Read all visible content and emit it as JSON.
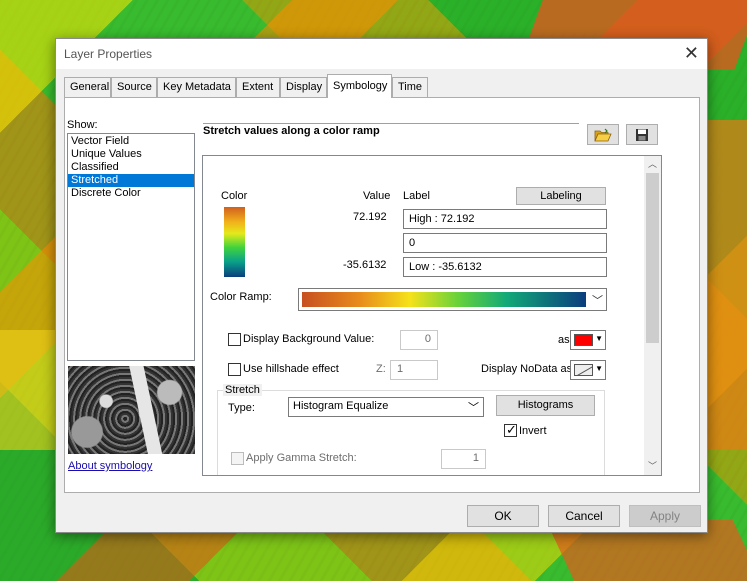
{
  "dialog": {
    "title": "Layer Properties",
    "close_glyph": "✕"
  },
  "tabs": [
    {
      "label": "General",
      "active": false
    },
    {
      "label": "Source",
      "active": false
    },
    {
      "label": "Key Metadata",
      "active": false
    },
    {
      "label": "Extent",
      "active": false
    },
    {
      "label": "Display",
      "active": false
    },
    {
      "label": "Symbology",
      "active": true
    },
    {
      "label": "Time",
      "active": false
    }
  ],
  "show": {
    "label": "Show:",
    "items": [
      "Vector Field",
      "Unique Values",
      "Classified",
      "Stretched",
      "Discrete Color"
    ],
    "selected": "Stretched"
  },
  "about_link": "About symbology",
  "description": "Stretch values along a color ramp",
  "icons": {
    "open": "open-folder-icon",
    "save": "save-disk-icon"
  },
  "color_table": {
    "color_header": "Color",
    "value_header": "Value",
    "label_header": "Label",
    "labeling_button": "Labeling",
    "high_value": "72.192",
    "low_value": "-35.6132",
    "high_label": "High : 72.192",
    "mid_label": "0",
    "low_label": "Low : -35.6132"
  },
  "color_ramp_label": "Color Ramp:",
  "background": {
    "label": "Display Background Value:",
    "checked": false,
    "value": "0",
    "as_label": "as",
    "color": "#ff0000"
  },
  "hillshade": {
    "label": "Use hillshade effect",
    "checked": false,
    "z_label": "Z:",
    "z_value": "1"
  },
  "nodata_label": "Display NoData as",
  "stretch": {
    "group_label": "Stretch",
    "type_label": "Type:",
    "type_value": "Histogram Equalize",
    "histograms_button": "Histograms",
    "invert_label": "Invert",
    "invert_checked": true,
    "gamma_label": "Apply Gamma Stretch:",
    "gamma_checked": false,
    "gamma_value": "1"
  },
  "footer": {
    "ok": "OK",
    "cancel": "Cancel",
    "apply": "Apply"
  },
  "colors": {
    "selection": "#0078d7",
    "ramp_start": "#c75021",
    "ramp_end": "#0b3d7e"
  }
}
